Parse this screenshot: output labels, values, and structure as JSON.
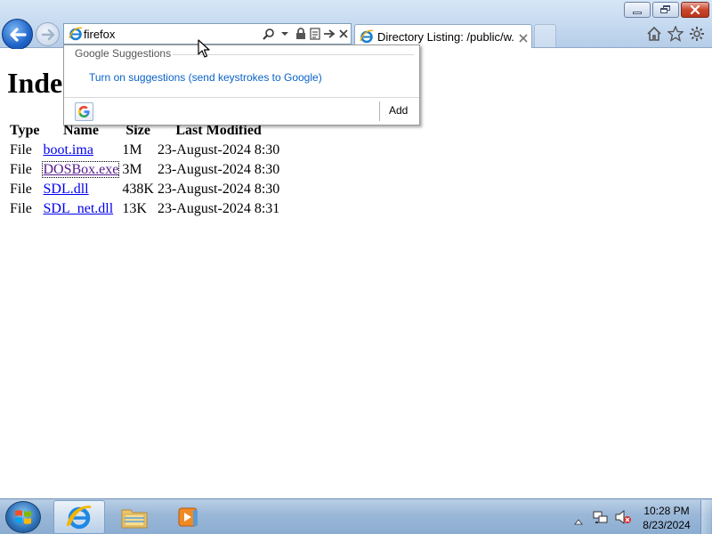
{
  "browser": {
    "address": {
      "value": "firefox",
      "icon": "ie-page-icon"
    },
    "tab": {
      "title": "Directory Listing: /public/w...",
      "icon": "ie-page-icon"
    },
    "toolbar_icons": [
      "home-icon",
      "favorites-star-icon",
      "gear-icon"
    ],
    "caption_buttons": [
      "minimize-button",
      "maximize-button",
      "close-button"
    ]
  },
  "suggestions": {
    "header": "Google Suggestions",
    "link": "Turn on suggestions (send keystrokes to Google)",
    "provider_icon": "google-icon",
    "add_label": "Add"
  },
  "page": {
    "heading": "Inde",
    "columns": [
      "Type",
      "Name",
      "Size",
      "Last Modified"
    ],
    "rows": [
      {
        "type": "File",
        "name": "boot.ima",
        "size": "1M",
        "modified": "23-August-2024 8:30"
      },
      {
        "type": "File",
        "name": "DOSBox.exe",
        "size": "3M",
        "modified": "23-August-2024 8:30"
      },
      {
        "type": "File",
        "name": "SDL.dll",
        "size": "438K",
        "modified": "23-August-2024 8:30"
      },
      {
        "type": "File",
        "name": "SDL_net.dll",
        "size": "13K",
        "modified": "23-August-2024 8:31"
      }
    ]
  },
  "taskbar": {
    "pinned": [
      "internet-explorer",
      "windows-explorer",
      "windows-media-player"
    ],
    "clock_time": "10:28 PM",
    "clock_date": "8/23/2024"
  },
  "colors": {
    "link": "#0000ee",
    "visited_link": "#551a8b",
    "suggestion_link": "#0a62c7",
    "close_button": "#c9462c"
  }
}
